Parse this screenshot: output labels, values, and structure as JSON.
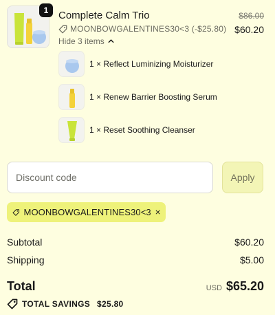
{
  "product": {
    "title": "Complete Calm Trio",
    "quantity": "1",
    "discount_line": "MOONBOWGALENTINES30<3 (-$25.80)",
    "original_price": "$86.00",
    "price": "$60.20",
    "hide_items_label": "Hide 3 items",
    "items": [
      {
        "label": "1 × Reflect Luminizing Moisturizer",
        "icon": "moisturizer-jar-icon"
      },
      {
        "label": "1 × Renew Barrier Boosting Serum",
        "icon": "serum-bottle-icon"
      },
      {
        "label": "1 × Reset Soothing Cleanser",
        "icon": "cleanser-tube-icon"
      }
    ]
  },
  "discount": {
    "placeholder": "Discount code",
    "apply_label": "Apply",
    "applied_code": "MOONBOWGALENTINES30<3"
  },
  "summary": {
    "subtotal_label": "Subtotal",
    "subtotal_value": "$60.20",
    "shipping_label": "Shipping",
    "shipping_value": "$5.00",
    "total_label": "Total",
    "currency": "USD",
    "total_value": "$65.20",
    "savings_label": "TOTAL SAVINGS",
    "savings_value": "$25.80"
  },
  "colors": {
    "background": "#fefee0",
    "chip": "#eef27a",
    "apply_button": "#f3f5b6",
    "serum_yellow": "#f4d23a",
    "cleanser_green": "#c9e43a",
    "moisturizer_blue": "#a9c8ee"
  }
}
